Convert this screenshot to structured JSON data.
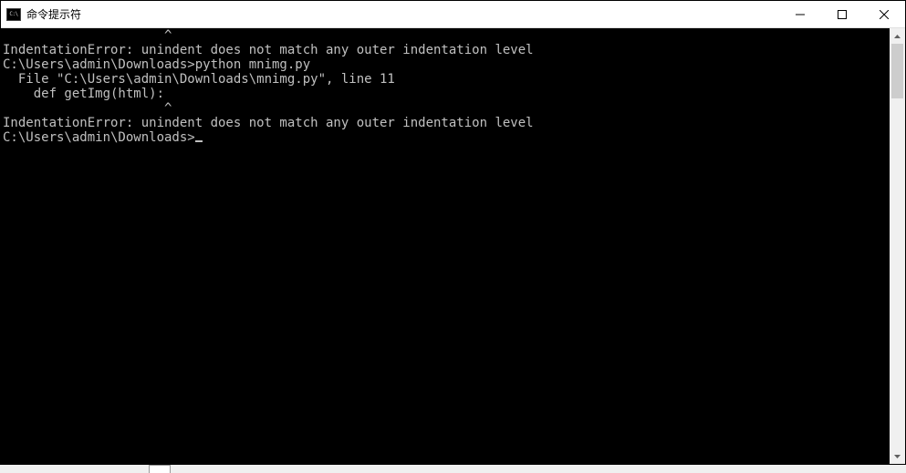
{
  "window": {
    "title": "命令提示符"
  },
  "terminal": {
    "lines": [
      "                     ^",
      "IndentationError: unindent does not match any outer indentation level",
      "",
      "C:\\Users\\admin\\Downloads>python mnimg.py",
      "  File \"C:\\Users\\admin\\Downloads\\mnimg.py\", line 11",
      "    def getImg(html):",
      "                     ^",
      "IndentationError: unindent does not match any outer indentation level",
      "",
      "C:\\Users\\admin\\Downloads>"
    ],
    "prompt_index": 9
  }
}
